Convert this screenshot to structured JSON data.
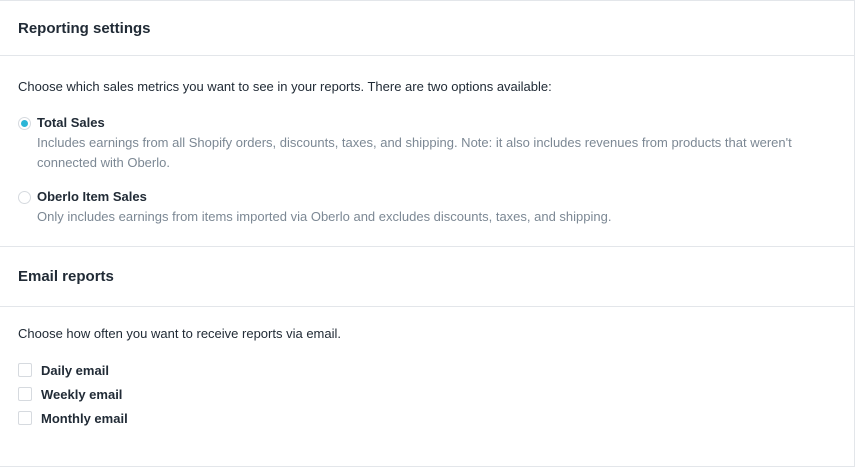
{
  "reporting": {
    "title": "Reporting settings",
    "intro": "Choose which sales metrics you want to see in your reports. There are two options available:",
    "options": [
      {
        "label": "Total Sales",
        "description": "Includes earnings from all Shopify orders, discounts, taxes, and shipping. Note: it also includes revenues from products that weren't connected with Oberlo.",
        "selected": true
      },
      {
        "label": "Oberlo Item Sales",
        "description": "Only includes earnings from items imported via Oberlo and excludes discounts, taxes, and shipping.",
        "selected": false
      }
    ]
  },
  "email": {
    "title": "Email reports",
    "intro": "Choose how often you want to receive reports via email.",
    "options": [
      {
        "label": "Daily email",
        "checked": false
      },
      {
        "label": "Weekly email",
        "checked": false
      },
      {
        "label": "Monthly email",
        "checked": false
      }
    ]
  },
  "colors": {
    "accent": "#2bb5d6",
    "border": "#e3e6ea",
    "text": "#212b36",
    "muted": "#7c8894"
  }
}
